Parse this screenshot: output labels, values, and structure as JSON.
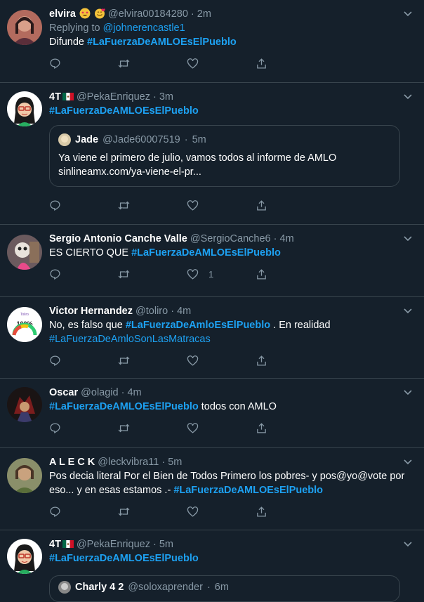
{
  "tweets": [
    {
      "name": "elvira",
      "handle": "@elvira00184280",
      "time": "2m",
      "replying_label": "Replying to",
      "replying_to": "@johnerencastle1",
      "text_before": "Difunde",
      "hashtag": "#LaFuerzaDeAMLOEsElPueblo",
      "avatar_color": "#c77b6b"
    },
    {
      "name": "4T",
      "handle": "@PekaEnriquez",
      "time": "3m",
      "hashtag": "#LaFuerzaDeAMLOEsElPueblo",
      "quote": {
        "name": "Jade",
        "handle": "@Jade60007519",
        "time": "5m",
        "text": "Ya viene el primero de julio, vamos todos al informe de AMLO",
        "link": "sinlineamx.com/ya-viene-el-pr..."
      }
    },
    {
      "name": "Sergio Antonio Canche Valle",
      "handle": "@SergioCanche6",
      "time": "4m",
      "text_before": "ES CIERTO QUE",
      "hashtag": "#LaFuerzaDeAMLOEsElPueblo",
      "like_count": "1"
    },
    {
      "name": "Victor Hernandez",
      "handle": "@toliro",
      "time": "4m",
      "text_before": "No, es falso que",
      "hashtag": "#LaFuerzaDeAmloEsElPueblo",
      "text_after": ". En realidad",
      "hashtag2": "#LaFuerzaDeAmloSonLasMatracas",
      "avatar_text": "100%",
      "avatar_small": "Toliro"
    },
    {
      "name": "Oscar",
      "handle": "@olagid",
      "time": "4m",
      "hashtag": "#LaFuerzaDeAMLOEsElPueblo",
      "text_after": "todos con AMLO"
    },
    {
      "name": "A L E C K",
      "handle": "@leckvibra11",
      "time": "5m",
      "line1": "Pos decia literal Por el Bien de Todos Primero los pobres- y pos@yo@vote por",
      "line2_before": "eso... y en esas estamos .-",
      "hashtag": "#LaFuerzaDeAMLOEsElPueblo"
    },
    {
      "name": "4T",
      "handle": "@PekaEnriquez",
      "time": "5m",
      "hashtag": "#LaFuerzaDeAMLOEsElPueblo",
      "quote": {
        "name": "Charly 4 2",
        "handle": "@soloxaprender",
        "time": "6m"
      }
    }
  ],
  "dot": "·"
}
